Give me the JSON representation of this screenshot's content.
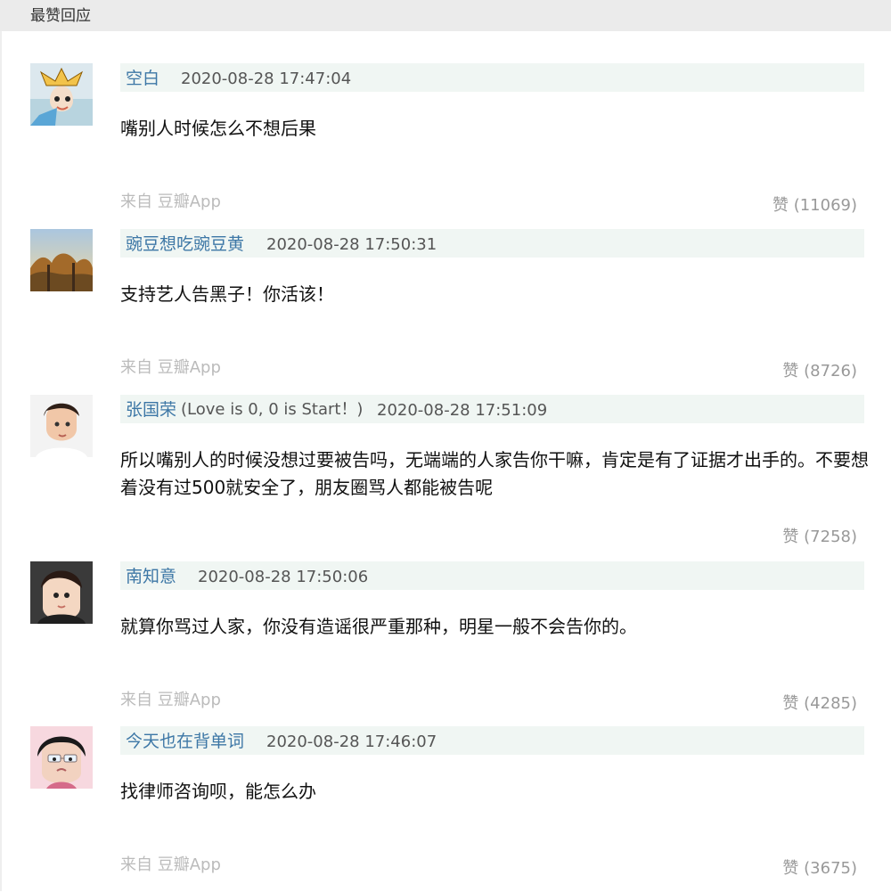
{
  "section": {
    "title": "最赞回应"
  },
  "comments": [
    {
      "avatar_icon": "user-avatar-icon",
      "author": "空白",
      "author_suffix": "",
      "timestamp": "2020-08-28 17:47:04",
      "text": "嘴别人时候怎么不想后果",
      "source": "来自 豆瓣App",
      "likes": "赞 (11069)"
    },
    {
      "avatar_icon": "user-avatar-icon",
      "author": "豌豆想吃豌豆黄",
      "author_suffix": "",
      "timestamp": "2020-08-28 17:50:31",
      "text": "支持艺人告黑子！你活该！",
      "source": "来自 豆瓣App",
      "likes": "赞 (8726)"
    },
    {
      "avatar_icon": "user-avatar-icon",
      "author": "张国荣",
      "author_suffix": "(Love is 0, 0 is Start！)",
      "timestamp": "2020-08-28 17:51:09",
      "text": "所以嘴别人的时候没想过要被告吗，无端端的人家告你干嘛，肯定是有了证据才出手的。不要想着没有过500就安全了，朋友圈骂人都能被告呢",
      "source": "",
      "likes": "赞 (7258)"
    },
    {
      "avatar_icon": "user-avatar-icon",
      "author": "南知意",
      "author_suffix": "",
      "timestamp": "2020-08-28 17:50:06",
      "text": "就算你骂过人家，你没有造谣很严重那种，明星一般不会告你的。",
      "source": "来自 豆瓣App",
      "likes": "赞 (4285)"
    },
    {
      "avatar_icon": "user-avatar-icon",
      "author": "今天也在背单词",
      "author_suffix": "",
      "timestamp": "2020-08-28 17:46:07",
      "text": "找律师咨询呗，能怎么办",
      "source": "来自 豆瓣App",
      "likes": "赞 (3675)"
    }
  ]
}
